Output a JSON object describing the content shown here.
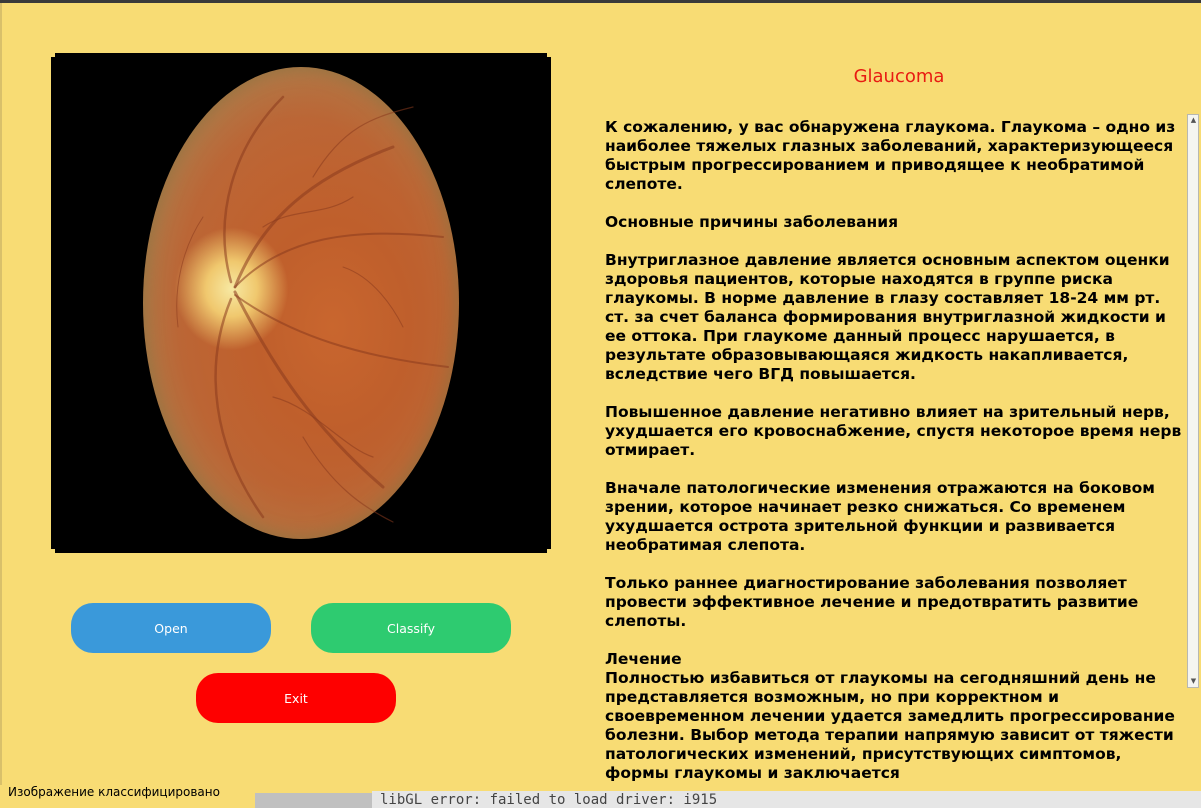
{
  "window": {
    "diagnosis_title": "Glaucoma",
    "title_color": "#e81b12"
  },
  "image_panel": {
    "image_icon": "retina-fundus-photo"
  },
  "description": {
    "paragraphs": [
      "К сожалению, у вас обнаружена глаукома. Глаукома – одно из наиболее тяжелых глазных заболеваний, характеризующееся быстрым прогрессированием и приводящее к необратимой слепоте.",
      "Основные причины заболевания",
      "Внутриглазное давление является основным аспектом оценки здоровья пациентов, которые находятся в группе риска глаукомы. В норме давление в глазу составляет 18-24 мм рт. ст. за счет баланса формирования внутриглазной жидкости и ее оттока. При глаукоме данный процесс нарушается, в результате образовывающаяся жидкость накапливается, вследствие чего ВГД повышается.",
      "Повышенное давление негативно влияет на зрительный нерв, ухудшается его кровоснабжение, спустя некоторое время нерв отмирает.",
      "Вначале патологические изменения отражаются на боковом зрении, которое начинает резко снижаться. Со временем ухудшается острота зрительной функции и развивается необратимая слепота.",
      "Только раннее диагностирование заболевания позволяет провести эффективное лечение и предотвратить развитие слепоты."
    ],
    "treatment_heading": "Лечение",
    "treatment_text": "Полностью избавиться от глаукомы на сегодняшний день не представляется возможным, но при корректном и своевременном лечении удается замедлить прогрессирование болезни. Выбор метода терапии напрямую зависит от тяжести патологических изменений, присутствующих симптомов, формы глаукомы и заключается"
  },
  "buttons": {
    "open_label": "Open",
    "open_color": "#3a99da",
    "classify_label": "Classify",
    "classify_color": "#2ecb70",
    "exit_label": "Exit",
    "exit_color": "#fe0000"
  },
  "statusbar": {
    "message": "Изображение классифицировано"
  },
  "background_terminal": {
    "visible_text": "libGL error: failed to load driver: i915"
  }
}
